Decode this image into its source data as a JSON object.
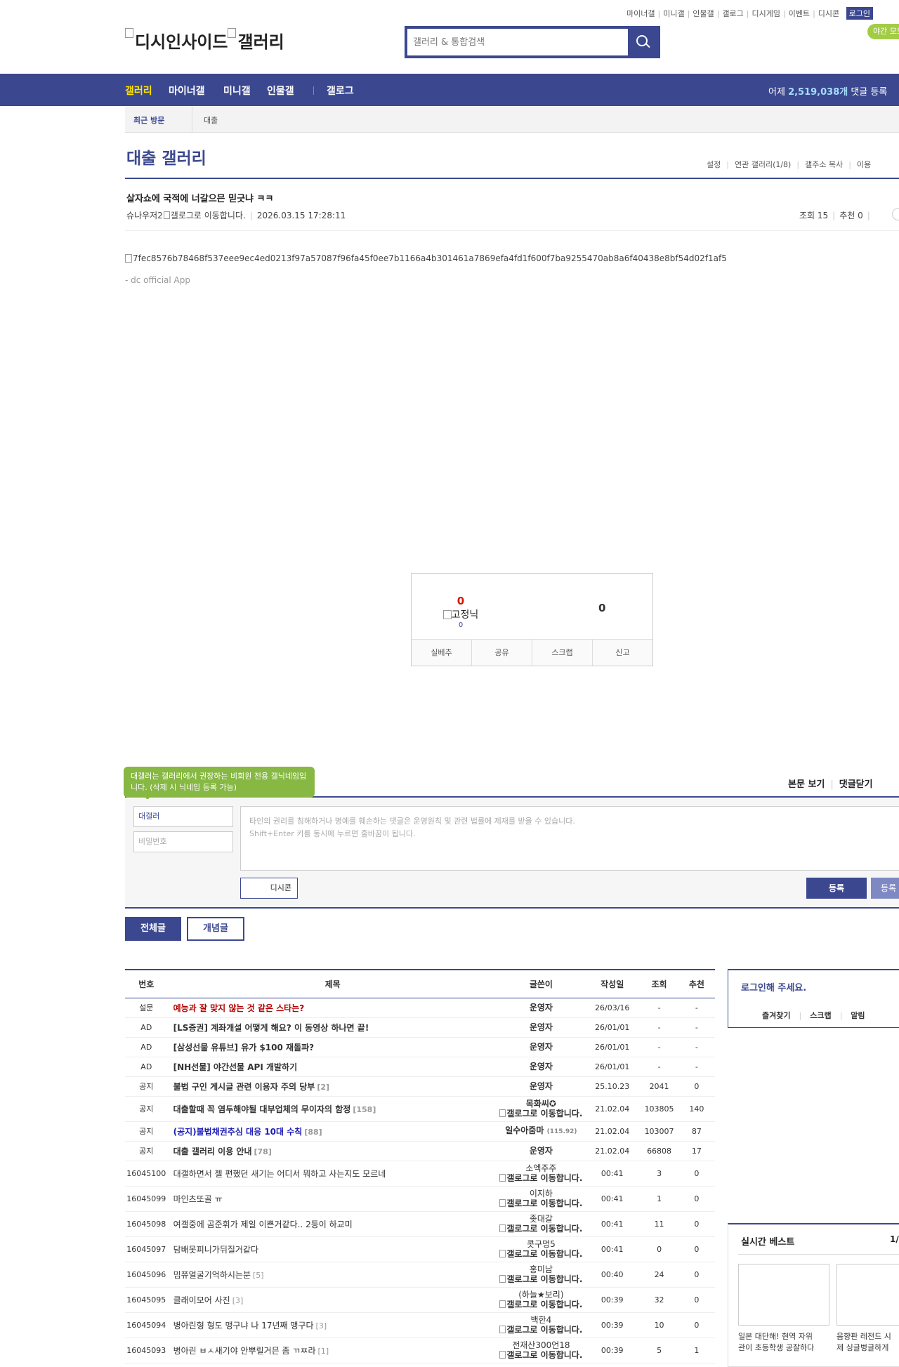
{
  "util": {
    "links": [
      "마이너갤",
      "미니갤",
      "인물갤",
      "갤로그",
      "디시게임",
      "이벤트",
      "디시콘"
    ],
    "login": "로그인",
    "night_mode": "야간 모드"
  },
  "logo": {
    "alt_site": "디시인사이드",
    "alt_gallery": "갤러리"
  },
  "search": {
    "placeholder": "갤러리 & 통합검색"
  },
  "gnb": {
    "items": [
      "갤러리",
      "마이너갤",
      "미니갤",
      "인물갤",
      "갤로그"
    ],
    "stats_prefix": "어제 ",
    "stats_count": "2,519,038개",
    "stats_suffix": " 댓글 등록"
  },
  "visit": {
    "label": "최근 방문",
    "link": "대출"
  },
  "gallery": {
    "title": "대출 갤러리",
    "tools": [
      "설정",
      "연관 갤러리(1/8)",
      "갤주소 복사",
      "이용"
    ]
  },
  "post": {
    "title": "살자쇼에 국적에 너갈으믄 믿긋냐 ㅋㅋ",
    "writer": "슈나우저2",
    "writer_gallog_alt": "갤로그로 이동합니다.",
    "date": "2026.03.15 17:28:11",
    "views": "조회 15",
    "recommend": "추천 0",
    "image_alt": "7fec8576b78468f537eee9ec4ed0213f97a57087f96fa45f0ee7b1166a4b301461a7869efa4fd1f600f7ba9255470ab8a6f40438e8bf54d02f1af5",
    "app_sign": "- dc official App"
  },
  "rec": {
    "up_count": "0",
    "fixnick": "고정닉",
    "fixnick_count": "0",
    "down_count": "0",
    "actions": [
      "실베추",
      "공유",
      "스크랩",
      "신고"
    ]
  },
  "comment": {
    "tooltip": "대갤러는 갤러리에서 권장하는 비회원 전용 갤닉네임입니다. (삭제 시 닉네임 등록 가능)",
    "links": [
      "본문 보기",
      "댓글닫기"
    ],
    "nick_value": "대갤러",
    "pw_placeholder": "비밀번호",
    "textarea_line1": "타인의 권리를 침해하거나 명예를 훼손하는 댓글은 운영원칙 및 관련 법률에 제재를 받을 수 있습니다.",
    "textarea_line2": "Shift+Enter 키를 동시에 누르면 줄바꿈이 됩니다.",
    "dccon": "디시콘",
    "submit": "등록",
    "submit2": "등록"
  },
  "tabs": {
    "all": "전체글",
    "concept": "개념글"
  },
  "list": {
    "headers": [
      "번호",
      "제목",
      "글쓴이",
      "작성일",
      "조회",
      "추천"
    ],
    "rows": [
      {
        "no": "설문",
        "subject": "예능과 잘 맞지 않는 것 같은 스타는?",
        "reply": "",
        "writer": "운영자",
        "gallog": "",
        "ip": "",
        "date": "26/03/16",
        "views": "-",
        "rec": "-",
        "kind": "survey"
      },
      {
        "no": "AD",
        "subject": "[LS증권] 계좌개설 어떻게 해요? 이 동영상 하나면 끝!",
        "reply": "",
        "writer": "운영자",
        "gallog": "",
        "ip": "",
        "date": "26/01/01",
        "views": "-",
        "rec": "-",
        "kind": "ad notice"
      },
      {
        "no": "AD",
        "subject": "[삼성선물 유튜브] 유가 $100 재돌파?",
        "reply": "",
        "writer": "운영자",
        "gallog": "",
        "ip": "",
        "date": "26/01/01",
        "views": "-",
        "rec": "-",
        "kind": "ad notice"
      },
      {
        "no": "AD",
        "subject": "[NH선물] 야간선물 API 개발하기",
        "reply": "",
        "writer": "운영자",
        "gallog": "",
        "ip": "",
        "date": "26/01/01",
        "views": "-",
        "rec": "-",
        "kind": "ad notice"
      },
      {
        "no": "공지",
        "subject": "불법 구인 게시글 관련 이용자 주의 당부",
        "reply": "[2]",
        "writer": "운영자",
        "gallog": "",
        "ip": "",
        "date": "25.10.23",
        "views": "2041",
        "rec": "0",
        "kind": "notice"
      },
      {
        "no": "공지",
        "subject": "대출할때 꼭 염두해야될 대부업체의 무이자의 함정",
        "reply": "[158]",
        "writer": "목화씨✪",
        "gallog": "갤로그로 이동합니다.",
        "ip": "",
        "date": "21.02.04",
        "views": "103805",
        "rec": "140",
        "kind": "notice tall"
      },
      {
        "no": "공지",
        "subject": "(공지)불법채권추심 대응 10대 수칙",
        "reply": "[88]",
        "writer": "일수아줌마",
        "gallog": "",
        "ip": "(115.92)",
        "date": "21.02.04",
        "views": "103007",
        "rec": "87",
        "kind": "notice blue"
      },
      {
        "no": "공지",
        "subject": "대출 갤러리 이용 안내",
        "reply": "[78]",
        "writer": "운영자",
        "gallog": "",
        "ip": "",
        "date": "21.02.04",
        "views": "66808",
        "rec": "17",
        "kind": "notice"
      },
      {
        "no": "16045100",
        "subject": "대갤하면서 젤 편했던 새기는 어디서 뭐하고 사는지도 모르네",
        "reply": "",
        "writer": "소엑주주",
        "gallog": "갤로그로 이동합니다.",
        "ip": "",
        "date": "00:41",
        "views": "3",
        "rec": "0",
        "kind": "tall"
      },
      {
        "no": "16045099",
        "subject": "마인츠또골 ㅠ",
        "reply": "",
        "writer": "이지하",
        "gallog": "갤로그로 이동합니다.",
        "ip": "",
        "date": "00:41",
        "views": "1",
        "rec": "0",
        "kind": "tall"
      },
      {
        "no": "16045098",
        "subject": "여갤중에 곰준휘가 제일 이쁜거같다.. 2등이 하교미",
        "reply": "",
        "writer": "좆대갈",
        "gallog": "갤로그로 이동합니다.",
        "ip": "",
        "date": "00:41",
        "views": "11",
        "rec": "0",
        "kind": "tall"
      },
      {
        "no": "16045097",
        "subject": "담배못피니가뒤질거같다",
        "reply": "",
        "writer": "콧구멍5",
        "gallog": "갤로그로 이동합니다.",
        "ip": "",
        "date": "00:41",
        "views": "0",
        "rec": "0",
        "kind": "tall"
      },
      {
        "no": "16045096",
        "subject": "밈쮸얼굴기억하시는분",
        "reply": "[5]",
        "writer": "홍미남",
        "gallog": "갤로그로 이동합니다.",
        "ip": "",
        "date": "00:40",
        "views": "24",
        "rec": "0",
        "kind": "tall"
      },
      {
        "no": "16045095",
        "subject": "클래이모어 사진",
        "reply": "[3]",
        "writer": "(하늘★보리)",
        "gallog": "갤로그로 이동합니다.",
        "ip": "",
        "date": "00:39",
        "views": "32",
        "rec": "0",
        "kind": "tall"
      },
      {
        "no": "16045094",
        "subject": "병아린형 형도 맹구냐 나 17년째 맹구다",
        "reply": "[3]",
        "writer": "백한4",
        "gallog": "갤로그로 이동합니다.",
        "ip": "",
        "date": "00:39",
        "views": "10",
        "rec": "0",
        "kind": "tall"
      },
      {
        "no": "16045093",
        "subject": "병아린 ㅂㅅ새기야 안뿌릴거믄 좀 ㄲㅉ라",
        "reply": "[1]",
        "writer": "전재산300언18",
        "gallog": "갤로그로 이동합니다.",
        "ip": "",
        "date": "00:39",
        "views": "5",
        "rec": "1",
        "kind": "tall"
      }
    ]
  },
  "sidebar": {
    "login_title": "로그인해 주세요.",
    "login_links": [
      "즐겨찾기",
      "스크랩",
      "알림"
    ],
    "best_title": "실시간 베스트",
    "best_page": "1/",
    "best_items": [
      {
        "caption1": "일본 대단해! 현역 자위",
        "caption2": "관이 초등학생 공잘하다"
      },
      {
        "caption1": "음향판 레전드 시",
        "caption2": "제 싱글벙글하게"
      }
    ]
  },
  "colors": {
    "brand": "#3b4890",
    "nav_active": "#ffe400",
    "tooltip": "#86b843",
    "survey": "#b30000"
  }
}
